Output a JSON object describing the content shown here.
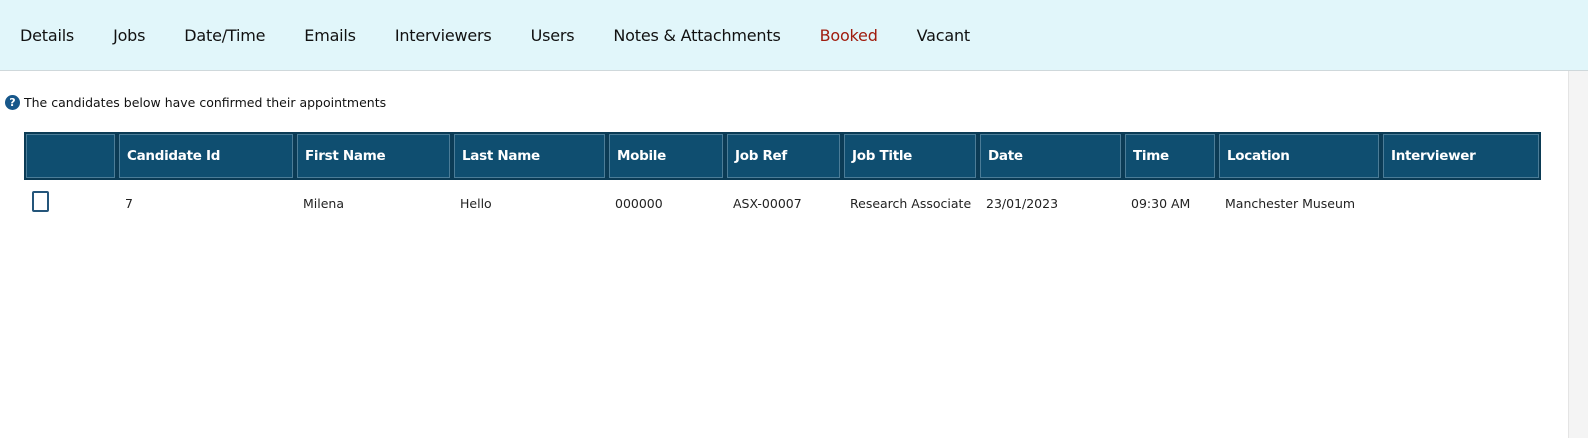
{
  "tabs": [
    {
      "label": "Details"
    },
    {
      "label": "Jobs"
    },
    {
      "label": "Date/Time"
    },
    {
      "label": "Emails"
    },
    {
      "label": "Interviewers"
    },
    {
      "label": "Users"
    },
    {
      "label": "Notes & Attachments"
    },
    {
      "label": "Booked",
      "active": true
    },
    {
      "label": "Vacant"
    }
  ],
  "colors": {
    "tabbar_bg": "#e1f6fa",
    "active_tab": "#a01c0e",
    "header_bg": "#0f4e70"
  },
  "info": {
    "icon": "question-icon",
    "glyph": "?",
    "text": "The candidates below have confirmed their appointments"
  },
  "table": {
    "columns": [
      "",
      "Candidate Id",
      "First Name",
      "Last Name",
      "Mobile",
      "Job Ref",
      "Job Title",
      "Date",
      "Time",
      "Location",
      "Interviewer"
    ],
    "rows": [
      {
        "checked": false,
        "candidate_id": "7",
        "first_name": "Milena",
        "last_name": "Hello",
        "mobile": "000000",
        "job_ref": "ASX-00007",
        "job_title": "Research Associate",
        "date": "23/01/2023",
        "time": "09:30 AM",
        "location": "Manchester Museum",
        "interviewer": ""
      }
    ]
  }
}
